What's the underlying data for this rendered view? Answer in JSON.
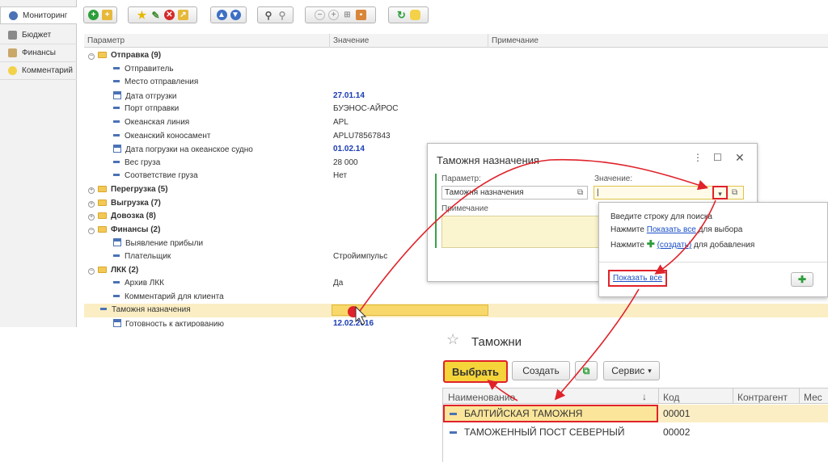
{
  "nav": {
    "items": [
      {
        "label": "Мониторинг",
        "icon": "globe-icon"
      },
      {
        "label": "Бюджет",
        "icon": "calculator-icon"
      },
      {
        "label": "Финансы",
        "icon": "finance-icon"
      },
      {
        "label": "Комментарий",
        "icon": "comment-icon"
      }
    ]
  },
  "grid": {
    "headers": [
      "Параметр",
      "Значение",
      "Примечание"
    ],
    "rows": [
      {
        "label": "Отправка (9)",
        "value": ""
      },
      {
        "label": "Отправитель",
        "value": ""
      },
      {
        "label": "Место отправления",
        "value": ""
      },
      {
        "label": "Дата отгрузки",
        "value": "27.01.14"
      },
      {
        "label": "Порт отправки",
        "value": "БУЭНОС-АЙРОС"
      },
      {
        "label": "Океанская линия",
        "value": "APL"
      },
      {
        "label": "Океанский коносамент",
        "value": "APLU78567843"
      },
      {
        "label": "Дата погрузки на океанское судно",
        "value": "01.02.14"
      },
      {
        "label": "Вес груза",
        "value": "28 000"
      },
      {
        "label": "Соответствие груза",
        "value": "Нет"
      },
      {
        "label": "Перегрузка (5)",
        "value": ""
      },
      {
        "label": "Выгрузка (7)",
        "value": ""
      },
      {
        "label": "Довозка (8)",
        "value": ""
      },
      {
        "label": "Финансы (2)",
        "value": ""
      },
      {
        "label": "Выявление прибыли",
        "value": ""
      },
      {
        "label": "Плательщик",
        "value": "Стройимпульс"
      },
      {
        "label": "ЛКК (2)",
        "value": ""
      },
      {
        "label": "Архив ЛКК",
        "value": "Да"
      },
      {
        "label": "Комментарий для клиента",
        "value": ""
      },
      {
        "label": "Таможня назначения",
        "value": ""
      },
      {
        "label": "Готовность к актированию",
        "value": "12.02.2016"
      }
    ]
  },
  "dialog": {
    "title": "Таможня назначения",
    "param_label": "Параметр:",
    "param_value": "Таможня назначения",
    "value_label": "Значение:",
    "value_value": "|",
    "note_label": "Примечание"
  },
  "dropdown": {
    "hint1": "Введите строку для поиска",
    "press": "Нажмите",
    "show_all": "Показать все",
    "for_select": "для выбора",
    "create": "(создать)",
    "for_add": "для добавления",
    "show_all_link": "Показать все"
  },
  "customs": {
    "title": "Таможни",
    "select_btn": "Выбрать",
    "create_btn": "Создать",
    "service_btn": "Сервис",
    "columns": [
      "Наименование",
      "Код",
      "Контрагент",
      "Мес"
    ],
    "rows": [
      {
        "name": "БАЛТИЙСКАЯ ТАМОЖНЯ",
        "code": "00001"
      },
      {
        "name": "ТАМОЖЕННЫЙ ПОСТ СЕВЕРНЫЙ",
        "code": "00002"
      }
    ]
  },
  "colors": {
    "accent": "#e0222a",
    "selection": "#fbeec4",
    "button_yellow": "#f5d43a"
  }
}
